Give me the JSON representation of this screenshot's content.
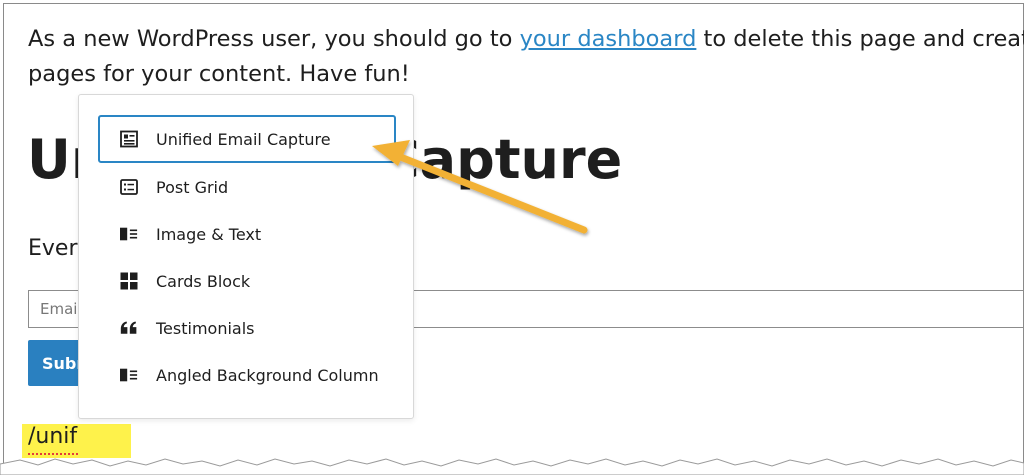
{
  "intro": {
    "before": "As a new WordPress user, you should go to ",
    "link": "your dashboard",
    "after": " to delete this page and create",
    "line2": "pages for your content. Have fun!"
  },
  "heading": {
    "start": "Ur",
    "end": "Capture"
  },
  "body_text": "Every",
  "email_placeholder": "Email",
  "submit_label": "Subm",
  "slash_command": "/unif",
  "block_menu": {
    "items": [
      {
        "label": "Unified Email Capture",
        "icon": "contact-card-icon"
      },
      {
        "label": "Post Grid",
        "icon": "list-icon"
      },
      {
        "label": "Image & Text",
        "icon": "media-text-icon"
      },
      {
        "label": "Cards Block",
        "icon": "grid-icon"
      },
      {
        "label": "Testimonials",
        "icon": "quote-icon"
      },
      {
        "label": "Angled Background Column",
        "icon": "media-text-icon"
      }
    ],
    "selected_index": 0
  },
  "colors": {
    "link": "#2a86c5",
    "highlight": "#fef24b",
    "arrow": "#f2b134",
    "button": "#2a80c0"
  }
}
